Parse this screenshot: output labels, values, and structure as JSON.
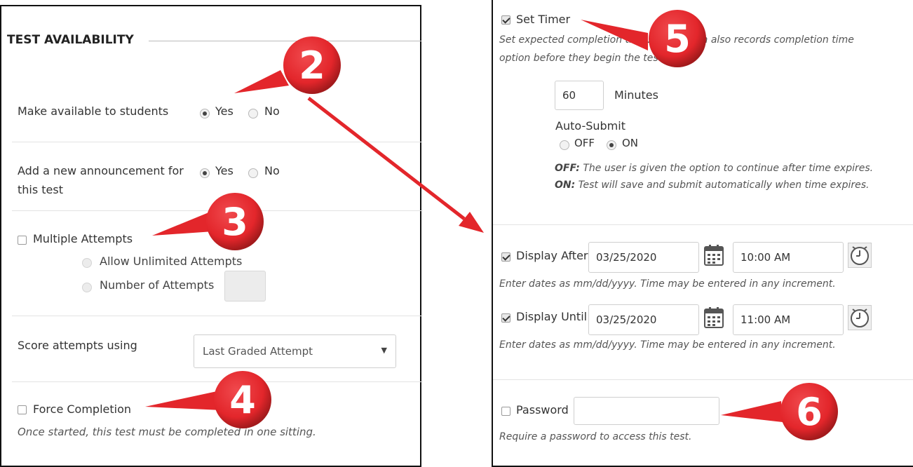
{
  "left": {
    "section_title": "TEST AVAILABILITY",
    "make_available": {
      "label": "Make available to students",
      "yes": "Yes",
      "no": "No",
      "selected": "Yes"
    },
    "announcement": {
      "label_line1": "Add a new announcement for",
      "label_line2": "this test",
      "yes": "Yes",
      "no": "No",
      "selected": "Yes"
    },
    "multiple_attempts": {
      "label": "Multiple Attempts",
      "checked": false,
      "unlimited": "Allow Unlimited Attempts",
      "number": "Number of Attempts",
      "number_value": ""
    },
    "score_attempts": {
      "label": "Score attempts using",
      "selected": "Last Graded Attempt"
    },
    "force_completion": {
      "label": "Force Completion",
      "checked": false,
      "hint": "Once started, this test must be completed in one sitting."
    }
  },
  "right": {
    "set_timer": {
      "label": "Set Timer",
      "checked": true,
      "hint_line1": "Set expected completion time. This option also records completion time",
      "hint_line2": "option before they begin the test.",
      "minutes_value": "60",
      "minutes_label": "Minutes",
      "auto_submit_label": "Auto-Submit",
      "off": "OFF",
      "on": "ON",
      "auto_submit_selected": "ON",
      "off_hint_key": "OFF:",
      "off_hint": " The user is given the option to continue after time expires.",
      "on_hint_key": "ON:",
      "on_hint": " Test will save and submit automatically when time expires."
    },
    "display_after": {
      "label": "Display After",
      "checked": true,
      "date": "03/25/2020",
      "time": "10:00 AM",
      "hint": "Enter dates as mm/dd/yyyy. Time may be entered in any increment."
    },
    "display_until": {
      "label": "Display Until",
      "checked": true,
      "date": "03/25/2020",
      "time": "11:00 AM",
      "hint": "Enter dates as mm/dd/yyyy. Time may be entered in any increment."
    },
    "password": {
      "label": "Password",
      "checked": false,
      "value": "",
      "hint": "Require a password to access this test."
    }
  },
  "callouts": [
    "2",
    "3",
    "4",
    "5",
    "6"
  ],
  "colors": {
    "callout_red": "#e3262b",
    "callout_dark": "#a31a1c",
    "text": "#333333"
  }
}
